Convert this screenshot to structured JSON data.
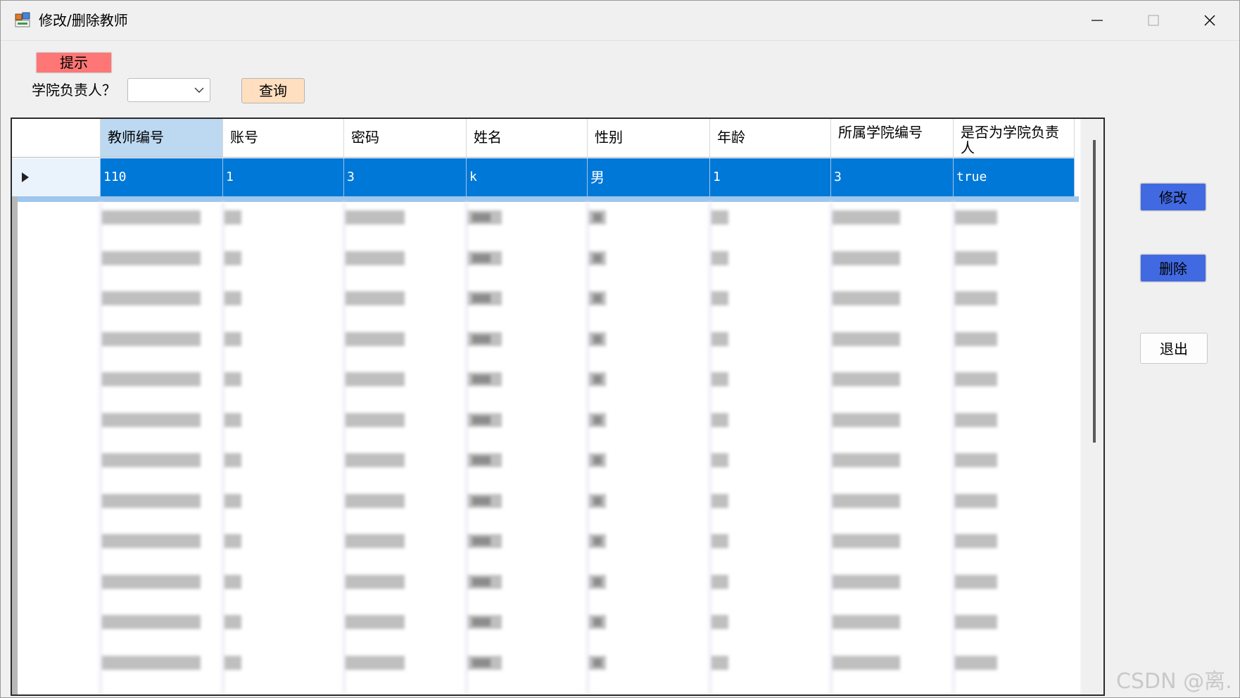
{
  "window": {
    "title": "修改/删除教师"
  },
  "toolbar": {
    "hint_button": "提示",
    "leader_label": "学院负责人？",
    "leader_select_value": "",
    "query_button": "查询"
  },
  "grid": {
    "columns": [
      "教师编号",
      "账号",
      "密码",
      "姓名",
      "性别",
      "年龄",
      "所属学院编号",
      "是否为学院负责人"
    ],
    "selected_row": [
      "110",
      "1",
      "3",
      "k",
      "男",
      "1",
      "3",
      "true"
    ]
  },
  "actions": {
    "modify": "修改",
    "delete": "删除",
    "exit": "退出"
  },
  "watermark": "CSDN @离.",
  "colors": {
    "hint_button": "#ff7676",
    "query_button": "#ffdfbf",
    "action_button": "#4169e1",
    "selected_row": "#0078d7",
    "selected_header": "#bcd9f1"
  }
}
